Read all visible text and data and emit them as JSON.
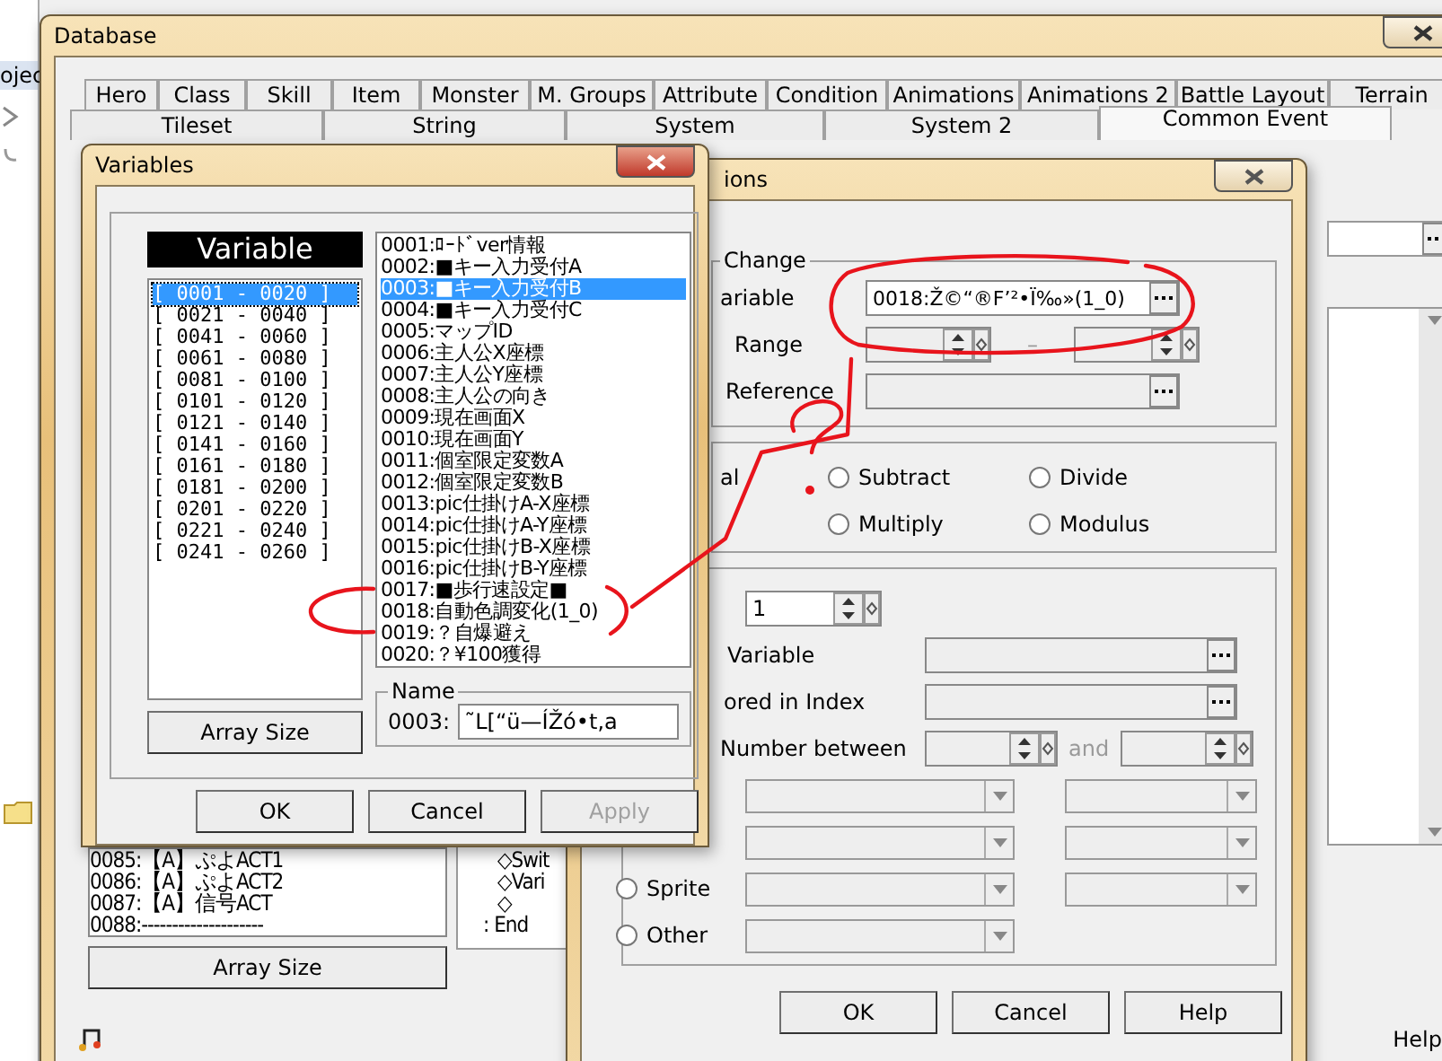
{
  "app": {
    "sidebar_text": "ojec"
  },
  "database": {
    "title": "Database",
    "tabs_row1": [
      {
        "label": "Hero",
        "selected": false
      },
      {
        "label": "Class",
        "selected": false
      },
      {
        "label": "Skill",
        "selected": false
      },
      {
        "label": "Item",
        "selected": false
      },
      {
        "label": "Monster",
        "selected": false
      },
      {
        "label": "M. Groups",
        "selected": false
      },
      {
        "label": "Attribute",
        "selected": false
      },
      {
        "label": "Condition",
        "selected": false
      },
      {
        "label": "Animations",
        "selected": false
      },
      {
        "label": "Animations 2",
        "selected": false
      },
      {
        "label": "Battle Layout",
        "selected": false
      },
      {
        "label": "Terrain",
        "selected": false
      }
    ],
    "tabs_row2": [
      {
        "label": "Tileset",
        "selected": false
      },
      {
        "label": "String",
        "selected": false
      },
      {
        "label": "System",
        "selected": false
      },
      {
        "label": "System 2",
        "selected": false
      },
      {
        "label": "Common Event",
        "selected": true
      }
    ],
    "common_events": [
      "0085:【A】ぷよACT1",
      "0086:【A】ぷよACT2",
      "0087:【A】信号ACT",
      "0088:--------------------"
    ],
    "array_size_button": "Array Size",
    "event_commands": [
      "◇Swit",
      "◇Vari",
      "◇",
      ": End"
    ],
    "help_button": "Help"
  },
  "variables_dialog": {
    "title": "Variables",
    "header": "Variable",
    "ranges": [
      {
        "label": "[ 0001 - 0020 ]",
        "selected": true
      },
      {
        "label": "[ 0021 - 0040 ]",
        "selected": false
      },
      {
        "label": "[ 0041 - 0060 ]",
        "selected": false
      },
      {
        "label": "[ 0061 - 0080 ]",
        "selected": false
      },
      {
        "label": "[ 0081 - 0100 ]",
        "selected": false
      },
      {
        "label": "[ 0101 - 0120 ]",
        "selected": false
      },
      {
        "label": "[ 0121 - 0140 ]",
        "selected": false
      },
      {
        "label": "[ 0141 - 0160 ]",
        "selected": false
      },
      {
        "label": "[ 0161 - 0180 ]",
        "selected": false
      },
      {
        "label": "[ 0181 - 0200 ]",
        "selected": false
      },
      {
        "label": "[ 0201 - 0220 ]",
        "selected": false
      },
      {
        "label": "[ 0221 - 0240 ]",
        "selected": false
      },
      {
        "label": "[ 0241 - 0260 ]",
        "selected": false
      }
    ],
    "variables": [
      {
        "label": "0001:ﾛｰﾄﾞver情報",
        "selected": false
      },
      {
        "label": "0002:■キー入力受付A",
        "selected": false
      },
      {
        "label": "0003:■キー入力受付B",
        "selected": true
      },
      {
        "label": "0004:■キー入力受付C",
        "selected": false
      },
      {
        "label": "0005:マップID",
        "selected": false
      },
      {
        "label": "0006:主人公X座標",
        "selected": false
      },
      {
        "label": "0007:主人公Y座標",
        "selected": false
      },
      {
        "label": "0008:主人公の向き",
        "selected": false
      },
      {
        "label": "0009:現在画面X",
        "selected": false
      },
      {
        "label": "0010:現在画面Y",
        "selected": false
      },
      {
        "label": "0011:個室限定変数A",
        "selected": false
      },
      {
        "label": "0012:個室限定変数B",
        "selected": false
      },
      {
        "label": "0013:pic仕掛けA-X座標",
        "selected": false
      },
      {
        "label": "0014:pic仕掛けA-Y座標",
        "selected": false
      },
      {
        "label": "0015:pic仕掛けB-X座標",
        "selected": false
      },
      {
        "label": "0016:pic仕掛けB-Y座標",
        "selected": false
      },
      {
        "label": "0017:■歩行速設定■",
        "selected": false
      },
      {
        "label": "0018:自動色調変化(1_0)",
        "selected": false
      },
      {
        "label": "0019:？自爆避え",
        "selected": false
      },
      {
        "label": "0020:？¥100獲得",
        "selected": false
      }
    ],
    "array_size_button": "Array Size",
    "name_legend": "Name",
    "name_id": "0003:",
    "name_value": "˜L[“ü—ÍŽó•t‚a",
    "buttons": [
      {
        "label": "OK",
        "disabled": false
      },
      {
        "label": "Cancel",
        "disabled": false
      },
      {
        "label": "Apply",
        "disabled": true
      }
    ]
  },
  "conditions_dialog": {
    "title": "ions",
    "group_label": "Change",
    "variable_label": "ariable",
    "variable_value": "0018:Ž©“®F’²•Ï‰»(1_0)",
    "range_label": "Range",
    "range_dash": "–",
    "reference_label": "Reference",
    "operation_label": "al",
    "operations": [
      {
        "label": "Subtract",
        "selected": false
      },
      {
        "label": "Divide",
        "selected": false
      },
      {
        "label": "Multiply",
        "selected": false
      },
      {
        "label": "Modulus",
        "selected": false
      }
    ],
    "constant_value": "1",
    "variable2_label": "Variable",
    "index_label": "ored in Index",
    "random_label": "Number between",
    "random_and": "and",
    "sources": [
      {
        "label": "Sprite",
        "selected": false
      },
      {
        "label": "Other",
        "selected": false
      }
    ],
    "buttons": [
      {
        "label": "OK",
        "disabled": false
      },
      {
        "label": "Cancel",
        "disabled": false
      },
      {
        "label": "Help",
        "disabled": false
      }
    ]
  }
}
